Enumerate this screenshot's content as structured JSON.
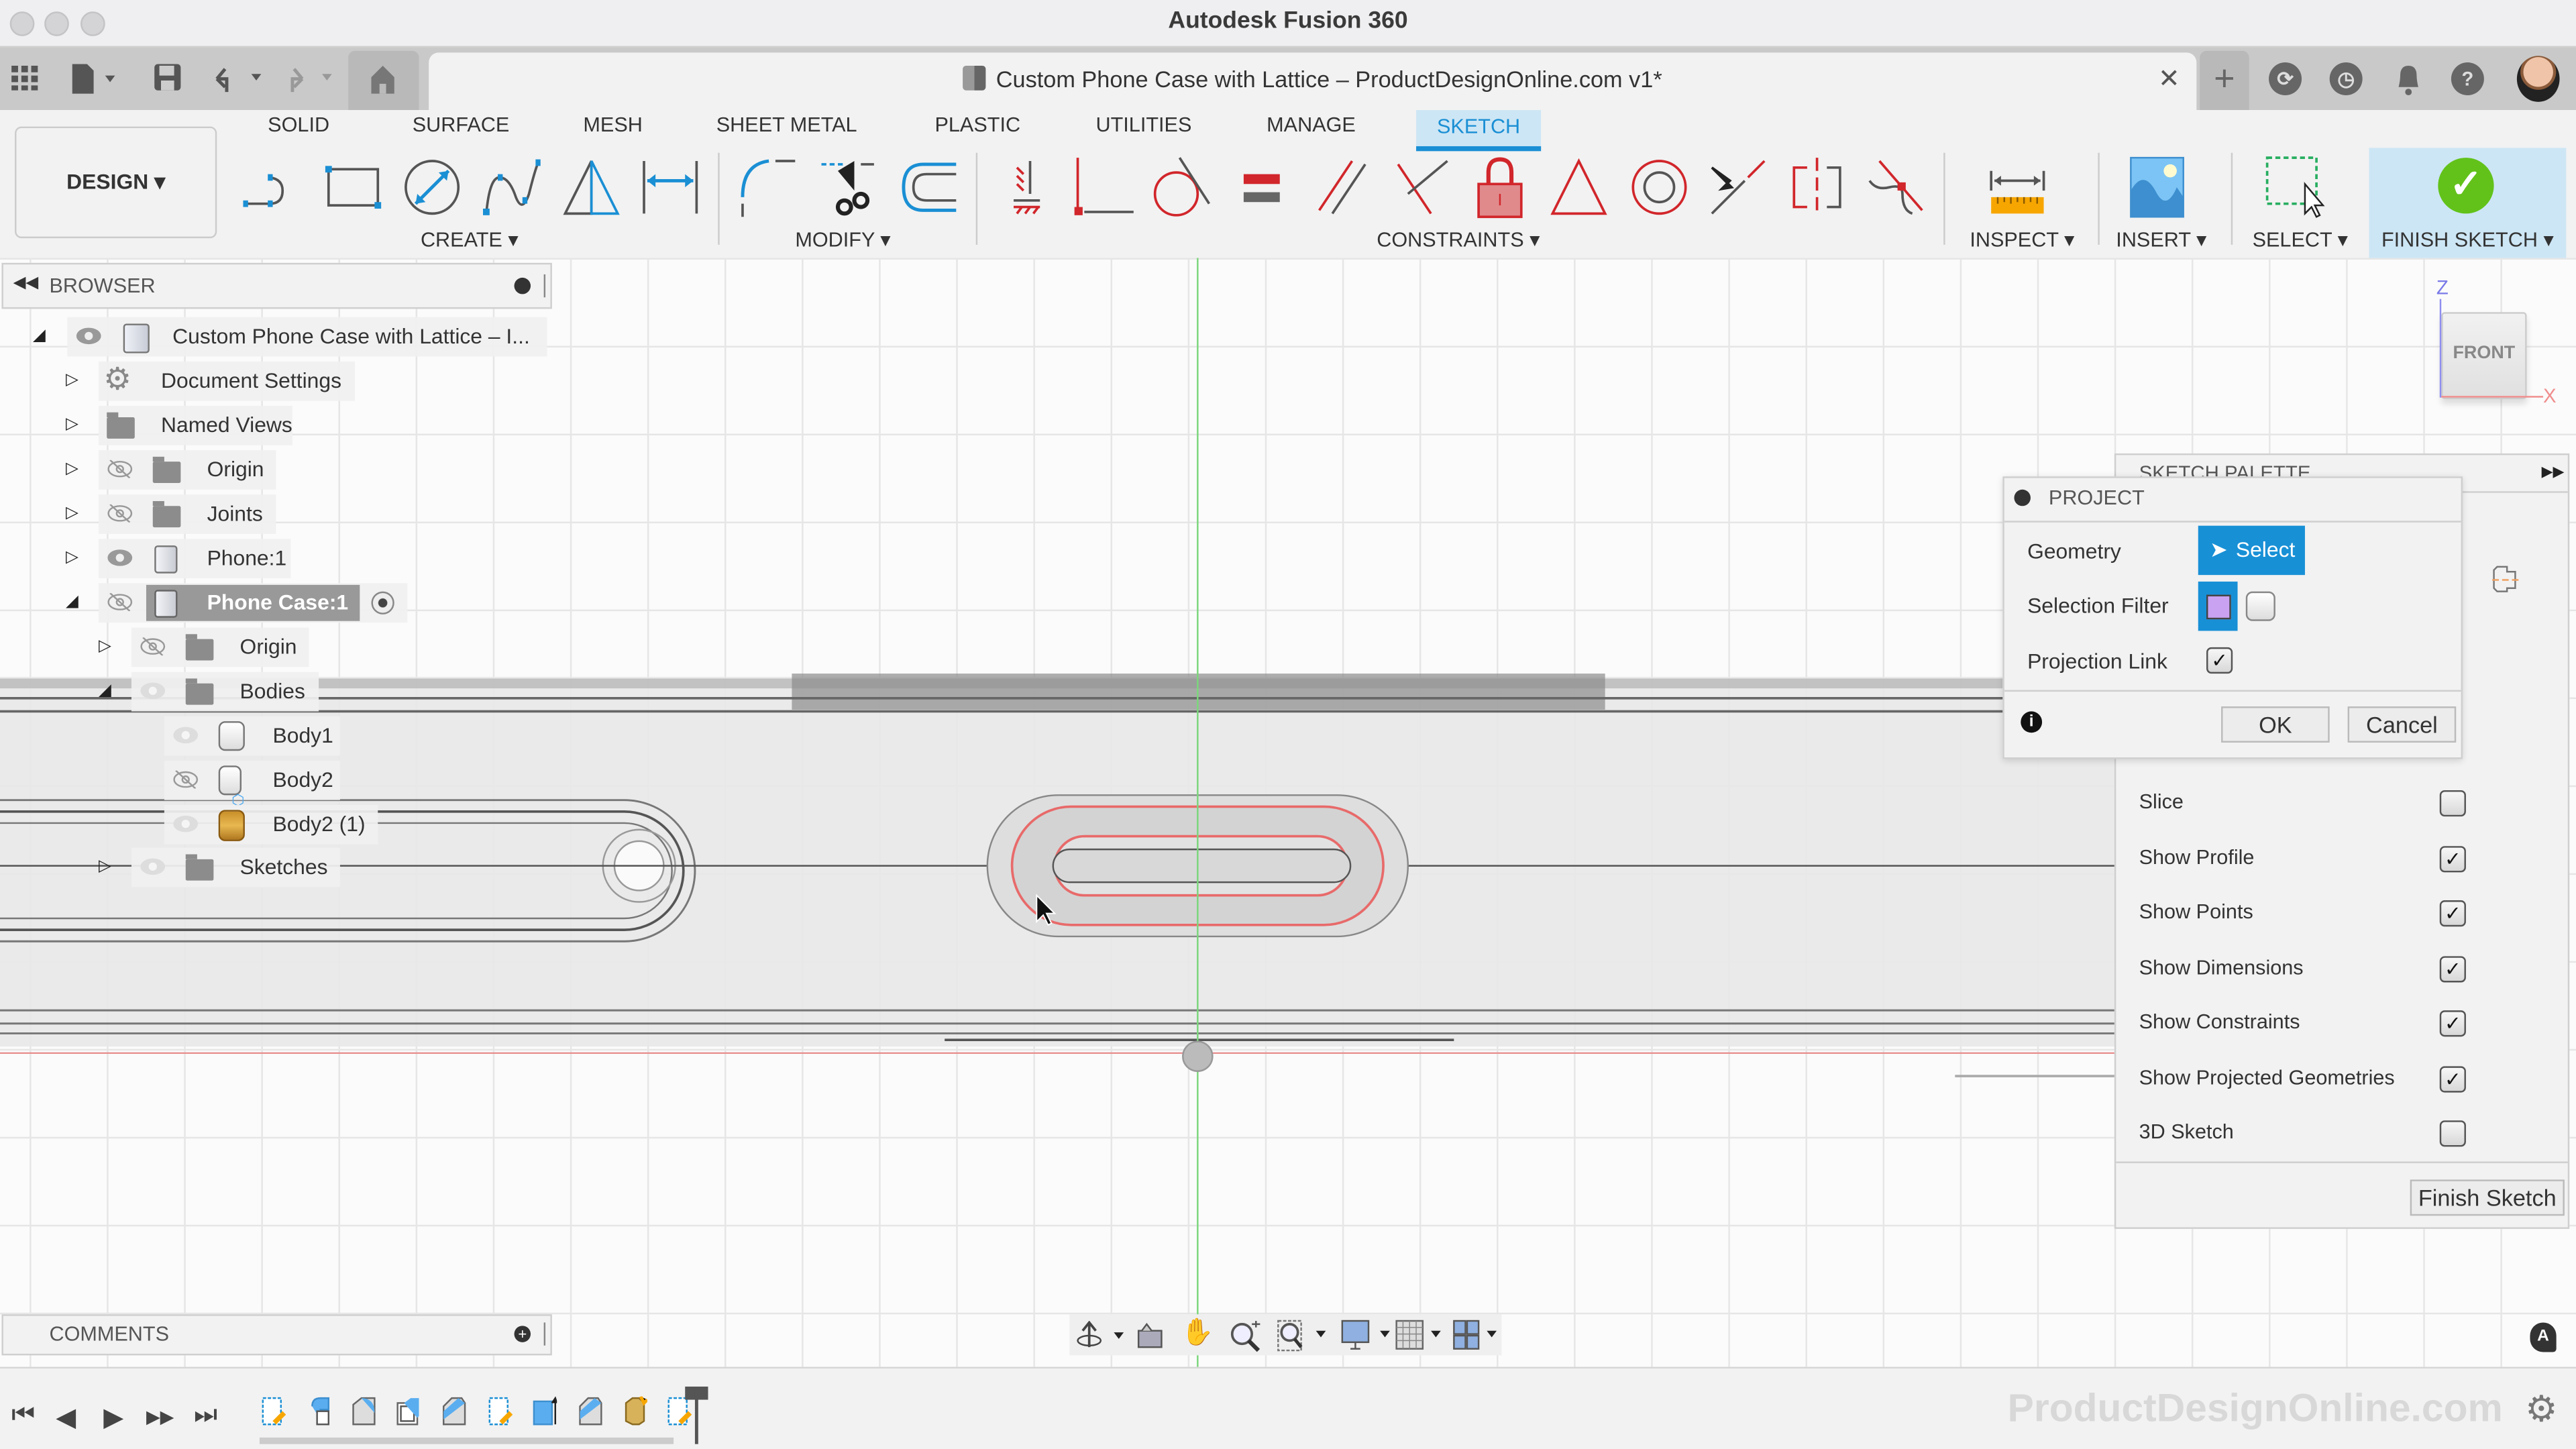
{
  "window": {
    "title": "Autodesk Fusion 360"
  },
  "quick_access": {
    "icons": [
      "app-grid-icon",
      "file-icon",
      "save-icon",
      "undo-icon",
      "redo-icon",
      "home-icon"
    ]
  },
  "document_tab": {
    "title": "Custom Phone Case with Lattice – ProductDesignOnline.com v1*",
    "close": "✕",
    "new": "+"
  },
  "top_right_icons": [
    "extensions-icon",
    "job-status-icon",
    "notifications-icon",
    "help-icon",
    "user-avatar"
  ],
  "workspace": {
    "label": "DESIGN ▾"
  },
  "ribbon_tabs": [
    {
      "label": "SOLID",
      "active": false
    },
    {
      "label": "SURFACE",
      "active": false
    },
    {
      "label": "MESH",
      "active": false
    },
    {
      "label": "SHEET METAL",
      "active": false
    },
    {
      "label": "PLASTIC",
      "active": false
    },
    {
      "label": "UTILITIES",
      "active": false
    },
    {
      "label": "MANAGE",
      "active": false
    },
    {
      "label": "SKETCH",
      "active": true
    }
  ],
  "ribbon_groups": {
    "create": "CREATE ▾",
    "modify": "MODIFY ▾",
    "constraints": "CONSTRAINTS ▾",
    "inspect": "INSPECT ▾",
    "insert": "INSERT ▾",
    "select": "SELECT ▾",
    "finish": "FINISH SKETCH ▾"
  },
  "tools": {
    "create": [
      "line",
      "rectangle",
      "circle",
      "spline",
      "mirror",
      "sketch-dimension"
    ],
    "modify": [
      "fillet",
      "trim",
      "offset"
    ],
    "constraints": [
      "fix",
      "coincident",
      "tangent",
      "equal",
      "parallel",
      "perpendicular",
      "lock",
      "midpoint",
      "concentric",
      "collinear",
      "symmetric",
      "curvature"
    ]
  },
  "browser": {
    "title": "BROWSER",
    "items": [
      {
        "label": "Custom Phone Case with Lattice – I...",
        "level": 0,
        "expanded": true,
        "visible": true,
        "icon": "component"
      },
      {
        "label": "Document Settings",
        "level": 1,
        "expanded": false,
        "icon": "gear"
      },
      {
        "label": "Named Views",
        "level": 1,
        "expanded": false,
        "icon": "folder"
      },
      {
        "label": "Origin",
        "level": 1,
        "expanded": false,
        "visible": false,
        "icon": "folder"
      },
      {
        "label": "Joints",
        "level": 1,
        "expanded": false,
        "visible": false,
        "icon": "folder"
      },
      {
        "label": "Phone:1",
        "level": 1,
        "expanded": false,
        "visible": true,
        "icon": "component"
      },
      {
        "label": "Phone Case:1",
        "level": 1,
        "expanded": true,
        "visible": false,
        "icon": "component",
        "active": true
      },
      {
        "label": "Origin",
        "level": 2,
        "expanded": false,
        "visible": false,
        "icon": "folder"
      },
      {
        "label": "Bodies",
        "level": 2,
        "expanded": true,
        "visible": true,
        "icon": "folder"
      },
      {
        "label": "Body1",
        "level": 3,
        "visible": true,
        "icon": "body"
      },
      {
        "label": "Body2",
        "level": 3,
        "visible": false,
        "icon": "lattice-body"
      },
      {
        "label": "Body2 (1)",
        "level": 3,
        "visible": true,
        "icon": "mesh-body"
      },
      {
        "label": "Sketches",
        "level": 2,
        "expanded": false,
        "visible": true,
        "icon": "folder"
      }
    ]
  },
  "viewcube": {
    "face": "FRONT",
    "axis_z": "Z",
    "axis_x": "X"
  },
  "project_dialog": {
    "title": "PROJECT",
    "geometry_label": "Geometry",
    "select_label": "Select",
    "selection_filter_label": "Selection Filter",
    "projection_link_label": "Projection Link",
    "projection_link_checked": true,
    "ok": "OK",
    "cancel": "Cancel"
  },
  "sketch_palette": {
    "title": "SKETCH PALETTE",
    "options": [
      {
        "label": "Slice",
        "checked": false
      },
      {
        "label": "Show Profile",
        "checked": true
      },
      {
        "label": "Show Points",
        "checked": true
      },
      {
        "label": "Show Dimensions",
        "checked": true
      },
      {
        "label": "Show Constraints",
        "checked": true
      },
      {
        "label": "Show Projected Geometries",
        "checked": true
      },
      {
        "label": "3D Sketch",
        "checked": false
      }
    ],
    "finish_button": "Finish Sketch"
  },
  "comments": {
    "title": "COMMENTS"
  },
  "nav_toolbar": [
    "orbit-icon",
    "look-at-icon",
    "pan-icon",
    "zoom-icon",
    "fit-icon",
    "display-settings-icon",
    "grid-snap-icon",
    "viewports-icon"
  ],
  "timeline": {
    "controls": [
      "⏮",
      "◀",
      "▶",
      "▶▶",
      "⏭"
    ],
    "features": [
      "sketch",
      "combine",
      "fillet",
      "shell",
      "split-body",
      "sketch",
      "extrude",
      "split-body",
      "volumetric-lattice",
      "sketch"
    ]
  },
  "watermark": "ProductDesignOnline.com",
  "colors": {
    "accent": "#1890d6",
    "sketch_tab_bg": "#cde6f5",
    "finish_green": "#62c21a",
    "constraint_red": "#d1262b",
    "profile_red": "#e86a6a"
  }
}
